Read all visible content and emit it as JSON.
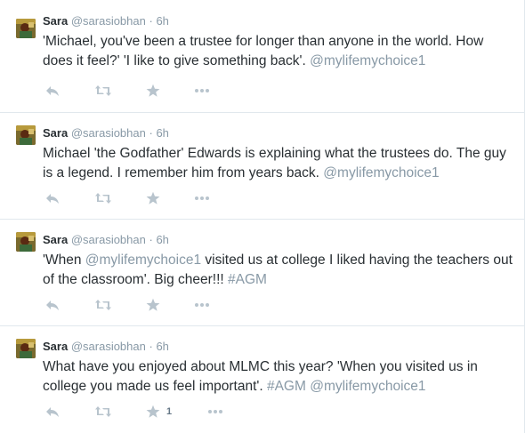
{
  "tweets": [
    {
      "fullname": "Sara",
      "username": "@sarasiobhan",
      "separator": "·",
      "time": "6h",
      "text_plain": "'Michael, you've been a trustee for longer than anyone in the world. How does it feel?' 'I like to give something back'. ",
      "mention": "@mylifemychoice1",
      "favorite_count": ""
    },
    {
      "fullname": "Sara",
      "username": "@sarasiobhan",
      "separator": "·",
      "time": "6h",
      "text_plain": "Michael 'the Godfather' Edwards is explaining what the trustees do. The guy is a legend. I remember him from years back. ",
      "mention": "@mylifemychoice1",
      "favorite_count": ""
    },
    {
      "fullname": "Sara",
      "username": "@sarasiobhan",
      "separator": "·",
      "time": "6h",
      "text_before": "'When ",
      "mention": "@mylifemychoice1",
      "text_after": " visited us at college I liked having the teachers out of the classroom'. Big cheer!!! ",
      "hashtag": "#AGM",
      "favorite_count": ""
    },
    {
      "fullname": "Sara",
      "username": "@sarasiobhan",
      "separator": "·",
      "time": "6h",
      "text_plain": "What have you enjoyed about MLMC this year? 'When you visited us in college you made us feel important'. ",
      "hashtag": "#AGM",
      "mention": "@mylifemychoice1",
      "favorite_count": "1"
    }
  ],
  "icons": {
    "reply": "reply-icon",
    "retweet": "retweet-icon",
    "favorite": "star-icon",
    "more": "more-icon"
  },
  "colors": {
    "text": "#292f33",
    "muted": "#8899a6",
    "action_icon": "#b8c4cd",
    "divider": "#e1e8ed"
  }
}
